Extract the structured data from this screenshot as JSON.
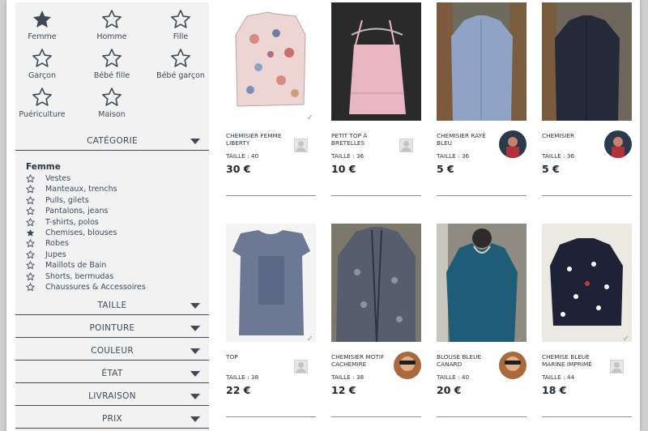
{
  "categories": [
    {
      "label": "Femme",
      "icon": "star-filled-icon",
      "selected": true
    },
    {
      "label": "Homme",
      "icon": "star-outline-icon",
      "selected": false
    },
    {
      "label": "Fille",
      "icon": "star-outline-icon",
      "selected": false
    },
    {
      "label": "Garçon",
      "icon": "star-outline-icon",
      "selected": false
    },
    {
      "label": "Bébé fille",
      "icon": "star-outline-icon",
      "selected": false
    },
    {
      "label": "Bébé garçon",
      "icon": "star-outline-icon",
      "selected": false
    },
    {
      "label": "Puériculture",
      "icon": "star-outline-icon",
      "selected": false
    },
    {
      "label": "Maison",
      "icon": "star-outline-icon",
      "selected": false
    }
  ],
  "filters": {
    "categorie": "CATÉGORIE",
    "taille": "TAILLE",
    "pointure": "POINTURE",
    "couleur": "COULEUR",
    "etat": "ÉTAT",
    "livraison": "LIVRAISON",
    "prix": "PRIX"
  },
  "subcategories": {
    "group_title": "Femme",
    "items": [
      {
        "label": "Vestes",
        "selected": false
      },
      {
        "label": "Manteaux, trenchs",
        "selected": false
      },
      {
        "label": "Pulls, gilets",
        "selected": false
      },
      {
        "label": "Pantalons, jeans",
        "selected": false
      },
      {
        "label": "T-shirts, polos",
        "selected": false
      },
      {
        "label": "Chemises, blouses",
        "selected": true
      },
      {
        "label": "Robes",
        "selected": false
      },
      {
        "label": "Jupes",
        "selected": false
      },
      {
        "label": "Maillots de Bain",
        "selected": false
      },
      {
        "label": "Shorts, bermudas",
        "selected": false
      },
      {
        "label": "Chaussures & Accessoires",
        "selected": false
      }
    ]
  },
  "products": [
    {
      "title": "CHEMISIER FEMME LIBERTY",
      "size": "TAILLE : 40",
      "price": "30 €",
      "seller": "placeholder",
      "bg": "#ffffff",
      "fg": "#e7c9c6"
    },
    {
      "title": "PETIT TOP À BRETELLES",
      "size": "TAILLE : 36",
      "price": "10 €",
      "seller": "placeholder",
      "bg": "#2a2a2a",
      "fg": "#e8b7c2"
    },
    {
      "title": "CHEMISIER RAYÉ BLEU",
      "size": "TAILLE : 36",
      "price": "5 €",
      "seller": "photo",
      "bg": "#6f6a5e",
      "fg": "#8fa3c7"
    },
    {
      "title": "CHEMISIER",
      "size": "TAILLE : 36",
      "price": "5 €",
      "seller": "photo",
      "bg": "#6d665a",
      "fg": "#242a38"
    },
    {
      "title": "TOP",
      "size": "TAILLE : 38",
      "price": "22 €",
      "seller": "placeholder",
      "bg": "#f4f4f4",
      "fg": "#6c7894"
    },
    {
      "title": "CHEMISIER MOTIF CACHEMIRE",
      "size": "TAILLE : 38",
      "price": "12 €",
      "seller": "photo",
      "bg": "#7d786c",
      "fg": "#565d6c"
    },
    {
      "title": "BLOUSE BLEUE CANARD",
      "size": "TAILLE : 40",
      "price": "20 €",
      "seller": "photo",
      "bg": "#8f8b82",
      "fg": "#1f5c78"
    },
    {
      "title": "CHEMISE BLEUE MARINE IMPRIMÉ",
      "size": "TAILLE : 44",
      "price": "18 €",
      "seller": "placeholder",
      "bg": "#ece9e2",
      "fg": "#1e2236"
    }
  ],
  "colors": {
    "accent": "#3f4a58",
    "sidebar_bg": "#f2f2f2",
    "background": "#cfcfcf"
  }
}
